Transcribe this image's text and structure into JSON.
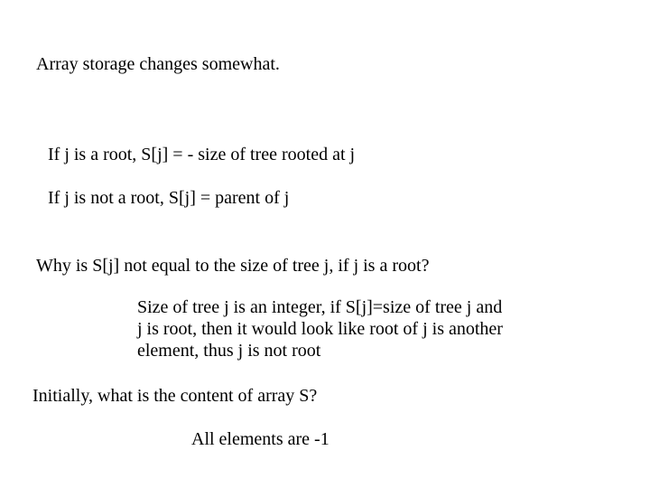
{
  "heading": "Array storage changes somewhat.",
  "rule1": "If j is a root, S[j]  =  -  size of tree rooted at j",
  "rule2": "If j is not a root, S[j] = parent of j",
  "question1": "Why is S[j] not equal to the size of tree j,  if j is a root?",
  "answer1_line1": "Size of tree j is an integer, if S[j]=size of tree j and",
  "answer1_line2": "j is root, then it would look like root of j is another",
  "answer1_line3": "element, thus j is not root",
  "question2": "Initially, what is the content of array S?",
  "answer2": "All elements are -1"
}
